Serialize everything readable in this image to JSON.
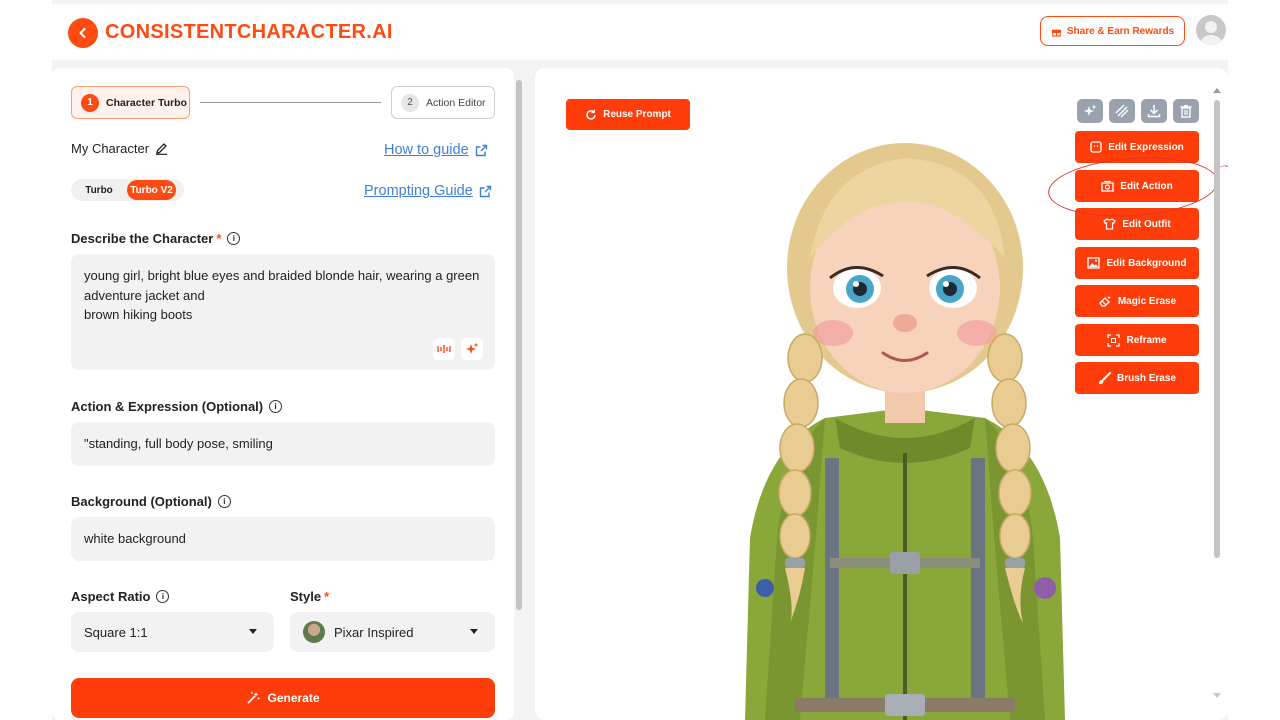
{
  "app": {
    "title": "CONSISTENTCHARACTER.AI",
    "share_label": "Share & Earn Rewards"
  },
  "steps": [
    {
      "num": "1",
      "label": "Character Turbo"
    },
    {
      "num": "2",
      "label": "Action Editor"
    }
  ],
  "character": {
    "name": "My Character",
    "how_to_guide": "How to guide",
    "prompting_guide": "Prompting Guide",
    "modes": [
      "Turbo",
      "Turbo V2"
    ],
    "active_mode": "Turbo V2"
  },
  "describe": {
    "label": "Describe the Character",
    "required": "*",
    "lines": [
      "young girl, bright blue eyes and braided blonde hair, wearing a green",
      "adventure jacket and",
      "brown hiking boots"
    ]
  },
  "action": {
    "label": "Action & Expression (Optional)",
    "value": "\"standing, full body pose, smiling"
  },
  "background": {
    "label": "Background (Optional)",
    "value": "white background"
  },
  "aspect": {
    "label": "Aspect Ratio",
    "value": "Square 1:1"
  },
  "style": {
    "label": "Style",
    "required": "*",
    "value": "Pixar Inspired"
  },
  "generate_label": "Generate",
  "image_panel": {
    "reuse_label": "Reuse Prompt",
    "tool_icons": [
      "sparkle-icon",
      "stripes-icon",
      "download-icon",
      "trash-icon"
    ],
    "edit_buttons": [
      "Edit Expression",
      "Edit Action",
      "Edit Outfit",
      "Edit Background",
      "Magic Erase",
      "Reframe",
      "Brush Erase"
    ],
    "highlighted": "Edit Action"
  },
  "colors": {
    "accent": "#ff3d0a",
    "link": "#3f7fd9",
    "annotation": "#e3322a"
  }
}
